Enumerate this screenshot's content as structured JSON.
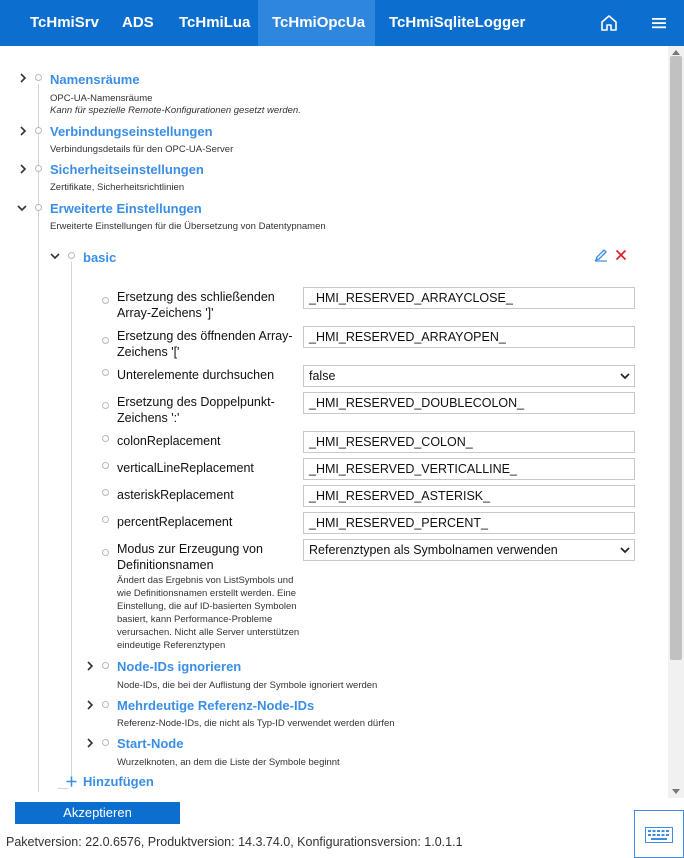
{
  "nav": {
    "tabs": [
      {
        "label": "TcHmiSrv",
        "active": false
      },
      {
        "label": "ADS",
        "active": false
      },
      {
        "label": "TcHmiLua",
        "active": false
      },
      {
        "label": "TcHmiOpcUa",
        "active": true
      },
      {
        "label": "TcHmiSqliteLogger",
        "active": false
      }
    ],
    "icons": [
      "home-icon",
      "hamburger-menu-icon"
    ]
  },
  "tree": {
    "sections": [
      {
        "title": "Namensräume",
        "desc": "OPC-UA-Namensräume",
        "desc2": "Kann für spezielle Remote-Konfigurationen gesetzt werden.",
        "expanded": false
      },
      {
        "title": "Verbindungseinstellungen",
        "desc": "Verbindungsdetails für den OPC-UA-Server",
        "expanded": false
      },
      {
        "title": "Sicherheitseinstellungen",
        "desc": "Zertifikate, Sicherheitsrichtlinien",
        "expanded": false
      },
      {
        "title": "Erweiterte Einstellungen",
        "desc": "Erweiterte Einstellungen für die Übersetzung von Datentypnamen",
        "expanded": true
      }
    ],
    "basic": {
      "title": "basic",
      "actions": [
        "edit-icon",
        "delete-icon"
      ],
      "properties": [
        {
          "label": "Ersetzung des schließenden Array-Zeichens ']'",
          "value": "_HMI_RESERVED_ARRAYCLOSE_",
          "type": "text"
        },
        {
          "label": "Ersetzung des öffnenden Array-Zeichens '['",
          "value": "_HMI_RESERVED_ARRAYOPEN_",
          "type": "text"
        },
        {
          "label": "Unterelemente durchsuchen",
          "value": "false",
          "type": "select"
        },
        {
          "label": "Ersetzung des Doppelpunkt-Zeichens ':'",
          "value": "_HMI_RESERVED_DOUBLECOLON_",
          "type": "text"
        },
        {
          "label": "colonReplacement",
          "value": "_HMI_RESERVED_COLON_",
          "type": "text"
        },
        {
          "label": "verticalLineReplacement",
          "value": "_HMI_RESERVED_VERTICALLINE_",
          "type": "text"
        },
        {
          "label": "asteriskReplacement",
          "value": "_HMI_RESERVED_ASTERISK_",
          "type": "text"
        },
        {
          "label": "percentReplacement",
          "value": "_HMI_RESERVED_PERCENT_",
          "type": "text"
        },
        {
          "label": "Modus zur Erzeugung von Definitionsnamen",
          "value": "Referenztypen als Symbolnamen verwenden",
          "type": "select",
          "help": "Ändert das Ergebnis von ListSymbols und wie Definitionsnamen erstellt werden. Eine Einstellung, die auf ID-basierten Symbolen basiert, kann Performance-Probleme verursachen. Nicht alle Server unterstützen eindeutige Referenztypen"
        }
      ],
      "subnodes": [
        {
          "title": "Node-IDs ignorieren",
          "desc": "Node-IDs, die bei der Auflistung der Symbole ignoriert werden"
        },
        {
          "title": "Mehrdeutige Referenz-Node-IDs",
          "desc": "Referenz-Node-IDs, die nicht als Typ-ID verwendet werden dürfen"
        },
        {
          "title": "Start-Node",
          "desc": "Wurzelknoten, an dem die Liste der Symbole beginnt"
        }
      ]
    },
    "add_label": "Hinzufügen"
  },
  "accept_label": "Akzeptieren",
  "footer": "Paketversion: 22.0.6576, Produktversion: 14.3.74.0, Konfigurationsversion: 1.0.1.1",
  "colors": {
    "nav": "#0c6fcf",
    "nav_active": "#2f86dd",
    "link": "#3a8ee6",
    "delete": "#e02020"
  }
}
